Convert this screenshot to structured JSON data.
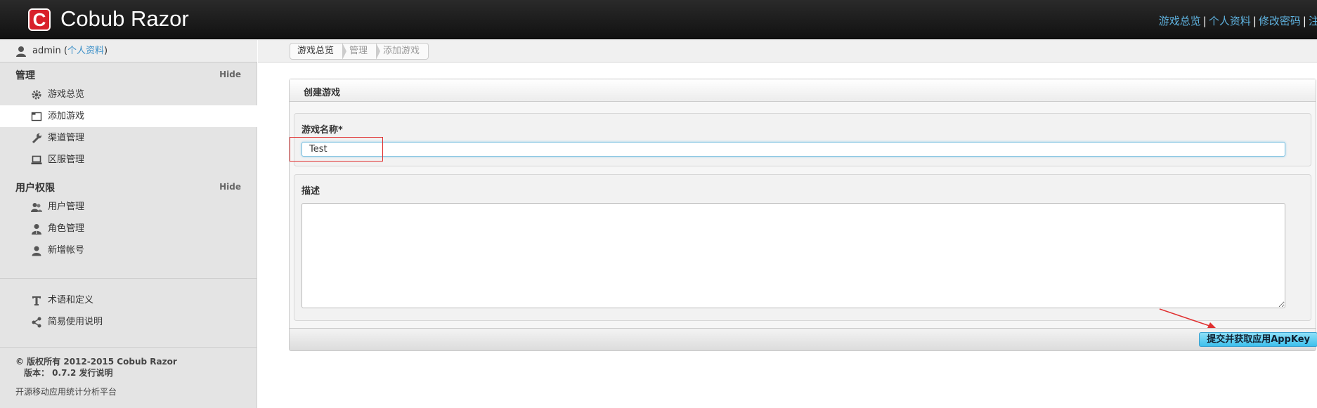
{
  "app": {
    "logo_letter": "C",
    "title": "Cobub Razor"
  },
  "top_links": [
    "游戏总览",
    "个人资料",
    "修改密码",
    "注销"
  ],
  "user": {
    "name": "admin",
    "profile_link": "个人资料"
  },
  "sections": [
    {
      "title": "管理",
      "hide_label": "Hide",
      "items": [
        {
          "label": "游戏总览",
          "icon": "gear-icon"
        },
        {
          "label": "添加游戏",
          "icon": "window-icon",
          "active": true
        },
        {
          "label": "渠道管理",
          "icon": "wrench-icon"
        },
        {
          "label": "区服管理",
          "icon": "laptop-icon"
        }
      ]
    },
    {
      "title": "用户权限",
      "hide_label": "Hide",
      "items": [
        {
          "label": "用户管理",
          "icon": "users-icon"
        },
        {
          "label": "角色管理",
          "icon": "role-icon"
        },
        {
          "label": "新增帐号",
          "icon": "user-add-icon"
        }
      ]
    }
  ],
  "extra_links": [
    {
      "label": "术语和定义",
      "icon": "text-icon"
    },
    {
      "label": "简易使用说明",
      "icon": "share-icon"
    }
  ],
  "footer": {
    "copyright": "© 版权所有 2012-2015 Cobub Razor",
    "version": "版本： 0.7.2 发行说明",
    "tagline": "开源移动应用统计分析平台"
  },
  "breadcrumb": [
    "游戏总览",
    "管理",
    "添加游戏"
  ],
  "form": {
    "title": "创建游戏",
    "name_label": "游戏名称*",
    "name_value": "Test",
    "desc_label": "描述",
    "desc_value": "",
    "submit_label": "提交并获取应用AppKey"
  },
  "colors": {
    "accent": "#3a8fc8",
    "highlight": "#e03030",
    "button": "#3ec0ec"
  }
}
